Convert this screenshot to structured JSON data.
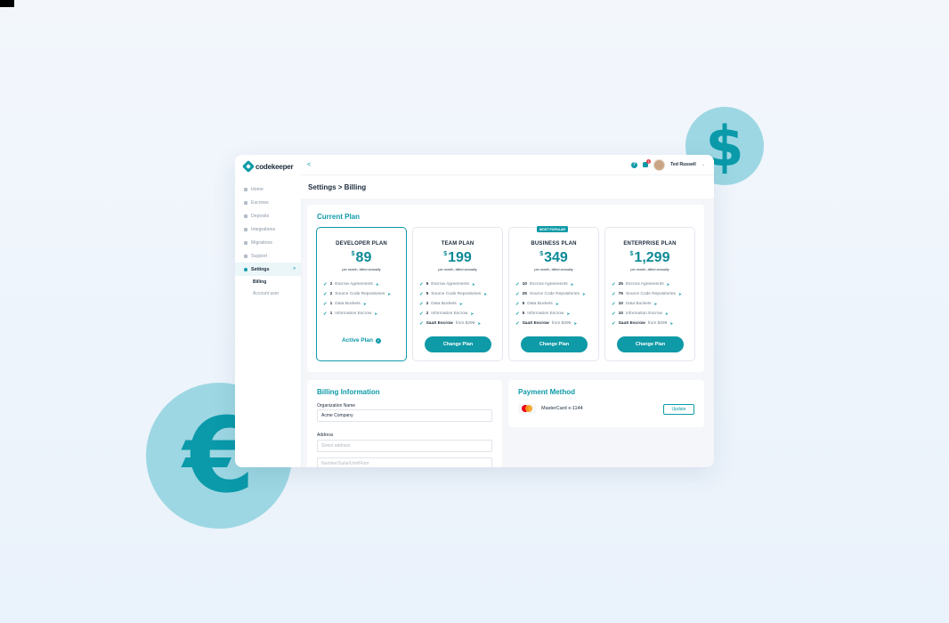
{
  "colors": {
    "accent": "#0e9aa7",
    "coin": "#9dd7e3",
    "badge_red": "#e0454f"
  },
  "decor": {
    "dollar": "$",
    "euro": "€"
  },
  "brand": {
    "name": "codekeeper"
  },
  "sidebar": {
    "items": [
      {
        "label": "Home",
        "icon": "home-icon"
      },
      {
        "label": "Escrows",
        "icon": "document-icon"
      },
      {
        "label": "Deposits",
        "icon": "document-icon"
      },
      {
        "label": "Integrations",
        "icon": "grid-icon"
      },
      {
        "label": "Migrations",
        "icon": "document-icon"
      },
      {
        "label": "Support",
        "icon": "support-icon"
      },
      {
        "label": "Settings",
        "icon": "gear-icon",
        "active": true
      }
    ],
    "settings_chevron": "^",
    "subitems": [
      {
        "label": "Billing",
        "active": true
      },
      {
        "label": "Account user"
      }
    ]
  },
  "topbar": {
    "back_icon": "<",
    "help_icon": "?",
    "notifications_count": "1",
    "user_name": "Ted Russell",
    "user_chevron": "⌄"
  },
  "header": {
    "breadcrumb": "Settings > Billing"
  },
  "current_plan": {
    "title": "Current Plan",
    "plans": [
      {
        "name": "DEVELOPER PLAN",
        "currency": "$",
        "price": "89",
        "billing": "per month, billed annually",
        "features": [
          {
            "num": "2",
            "text": "Escrow Agreements"
          },
          {
            "num": "2",
            "text": "Source Code Repositories"
          },
          {
            "num": "1",
            "text": "Data Buckets"
          },
          {
            "num": "1",
            "text": "Information Escrow"
          }
        ],
        "active_label": "Active Plan"
      },
      {
        "name": "TEAM PLAN",
        "currency": "$",
        "price": "199",
        "billing": "per month, billed annually",
        "features": [
          {
            "num": "5",
            "text": "Escrow Agreements"
          },
          {
            "num": "5",
            "text": "Source Code Repositories"
          },
          {
            "num": "2",
            "text": "Data Buckets"
          },
          {
            "num": "2",
            "text": "Information Escrow"
          },
          {
            "num": "SaaS Escrow",
            "text": "from $299"
          }
        ],
        "button_label": "Change Plan"
      },
      {
        "name": "BUSINESS PLAN",
        "currency": "$",
        "price": "349",
        "billing": "per month, billed annually",
        "badge": "MOST POPULAR",
        "features": [
          {
            "num": "10",
            "text": "Escrow Agreements"
          },
          {
            "num": "25",
            "text": "Source Code Repositories"
          },
          {
            "num": "5",
            "text": "Data Buckets"
          },
          {
            "num": "5",
            "text": "Information Escrow"
          },
          {
            "num": "SaaS Escrow",
            "text": "from $299"
          }
        ],
        "button_label": "Change Plan"
      },
      {
        "name": "ENTERPRISE PLAN",
        "currency": "$",
        "price": "1,299",
        "billing": "per month, billed annually",
        "features": [
          {
            "num": "25",
            "text": "Escrow Agreements"
          },
          {
            "num": "75",
            "text": "Source Code Repositories"
          },
          {
            "num": "10",
            "text": "Data Buckets"
          },
          {
            "num": "10",
            "text": "Information Escrow"
          },
          {
            "num": "SaaS Escrow",
            "text": "from $299"
          }
        ],
        "button_label": "Change Plan"
      }
    ]
  },
  "billing_info": {
    "title": "Billing Information",
    "org_label": "Organization Name",
    "org_value": "Acme Company",
    "address_label": "Address",
    "street_placeholder": "Street address",
    "unit_placeholder": "Number/Suite/Unit/Floor"
  },
  "payment": {
    "title": "Payment Method",
    "card_text": "MasterCard x-1144",
    "update_label": "Update"
  }
}
